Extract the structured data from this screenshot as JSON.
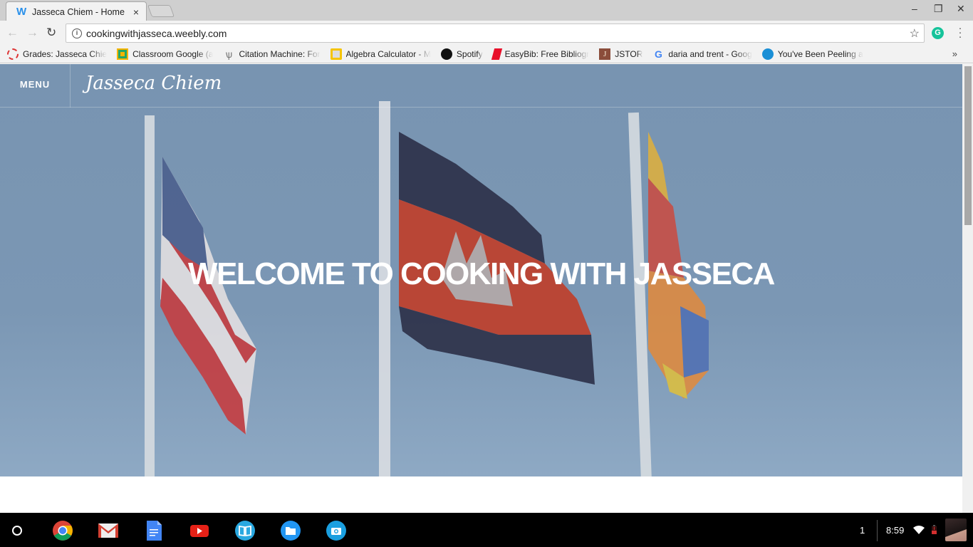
{
  "browser": {
    "tab": {
      "title": "Jasseca Chiem - Home",
      "favicon": "weebly-icon",
      "close": "×"
    },
    "window_controls": {
      "minimize": "–",
      "restore": "❐",
      "close": "✕"
    },
    "nav": {
      "back": "←",
      "forward": "→",
      "reload": "↻"
    },
    "url": "cookingwithjasseca.weebly.com",
    "info_icon": "i",
    "star": "☆",
    "grammarly": "G",
    "menu": "⋮",
    "bookmarks_overflow": "»",
    "bookmarks": [
      {
        "label": "Grades: Jasseca Chie",
        "icon": "grades-icon"
      },
      {
        "label": "Classroom Google (a",
        "icon": "classroom-icon"
      },
      {
        "label": "Citation Machine: For",
        "icon": "citation-machine-icon"
      },
      {
        "label": "Algebra Calculator - M",
        "icon": "algebra-calculator-icon"
      },
      {
        "label": "Spotify",
        "icon": "spotify-icon"
      },
      {
        "label": "EasyBib: Free Bibliogr",
        "icon": "easybib-icon"
      },
      {
        "label": "JSTOR",
        "icon": "jstor-icon"
      },
      {
        "label": "daria and trent - Goog",
        "icon": "google-icon"
      },
      {
        "label": "You've Been Peeling a",
        "icon": "peeling-icon"
      }
    ]
  },
  "site": {
    "menu_label": "MENU",
    "title": "Jasseca Chiem",
    "headline": "WELCOME TO COOKING WITH JASSECA"
  },
  "shelf": {
    "apps": [
      "chrome",
      "gmail",
      "docs",
      "youtube",
      "books",
      "files",
      "camera"
    ],
    "notification_count": "1",
    "time": "8:59"
  }
}
